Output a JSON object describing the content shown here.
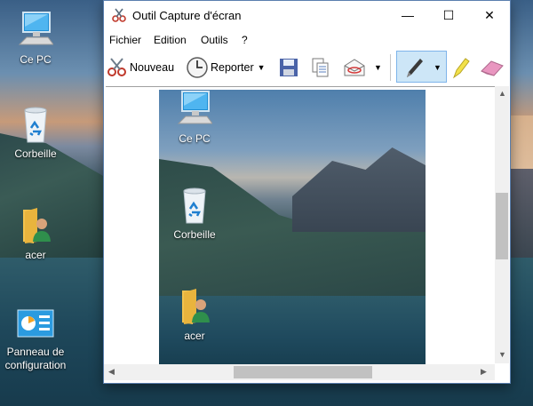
{
  "desktop": {
    "icons": [
      {
        "label": "Ce PC",
        "icon": "computer-icon"
      },
      {
        "label": "Corbeille",
        "icon": "recycle-bin-icon"
      },
      {
        "label": "acer",
        "icon": "user-folder-icon"
      },
      {
        "label": "Panneau de",
        "label2": "configuration",
        "icon": "control-panel-icon"
      }
    ]
  },
  "window": {
    "title": "Outil Capture d'écran",
    "controls": {
      "minimize": "—",
      "maximize": "☐",
      "close": "✕"
    },
    "menu": [
      "Fichier",
      "Edition",
      "Outils",
      "?"
    ],
    "toolbar": {
      "new_label": "Nouveau",
      "delay_label": "Reporter",
      "pen_selected": true
    },
    "capture_icons": [
      {
        "label": "Ce PC"
      },
      {
        "label": "Corbeille"
      },
      {
        "label": "acer"
      }
    ]
  }
}
